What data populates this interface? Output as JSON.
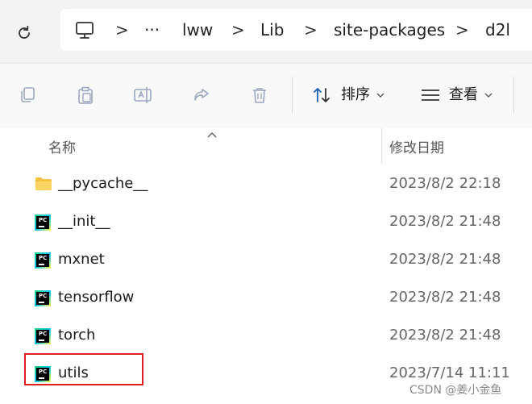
{
  "address_bar": {
    "crumbs": [
      "lww",
      "Lib",
      "site-packages",
      "d2l"
    ],
    "overflow": "···",
    "separator": ">"
  },
  "toolbar": {
    "sort_label": "排序",
    "view_label": "查看"
  },
  "list": {
    "columns": {
      "name": "名称",
      "date": "修改日期"
    },
    "rows": [
      {
        "name": "__pycache__",
        "date": "2023/8/2 22:18",
        "icon": "folder-icon"
      },
      {
        "name": "__init__",
        "date": "2023/8/2 21:48",
        "icon": "pycharm-file-icon"
      },
      {
        "name": "mxnet",
        "date": "2023/8/2 21:48",
        "icon": "pycharm-file-icon"
      },
      {
        "name": "tensorflow",
        "date": "2023/8/2 21:48",
        "icon": "pycharm-file-icon"
      },
      {
        "name": "torch",
        "date": "2023/8/2 21:48",
        "icon": "pycharm-file-icon"
      },
      {
        "name": "utils",
        "date": "2023/7/14 11:11",
        "icon": "pycharm-file-icon"
      }
    ]
  },
  "icons": {
    "pycharm_label": "PC"
  },
  "watermark": "CSDN @姜小金鱼",
  "colors": {
    "highlight": "#e02020",
    "folder": "#f5c142"
  }
}
